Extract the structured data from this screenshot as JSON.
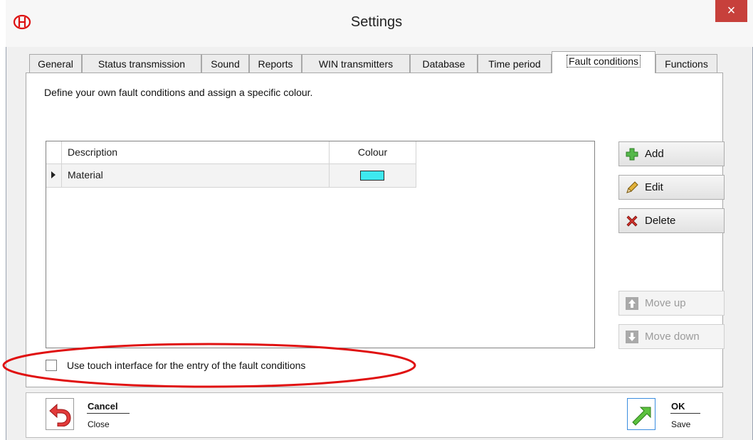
{
  "window": {
    "title": "Settings",
    "close_glyph": "×",
    "logo_icon": "company-logo"
  },
  "tabs": [
    {
      "label": "General",
      "active": false
    },
    {
      "label": "Status transmission",
      "active": false
    },
    {
      "label": "Sound",
      "active": false
    },
    {
      "label": "Reports",
      "active": false
    },
    {
      "label": "WIN transmitters",
      "active": false
    },
    {
      "label": "Database",
      "active": false
    },
    {
      "label": "Time period",
      "active": false
    },
    {
      "label": "Fault conditions",
      "active": true
    },
    {
      "label": "Functions",
      "active": false
    }
  ],
  "panel": {
    "description": "Define your own fault conditions and assign a specific colour.",
    "grid": {
      "columns": [
        "Description",
        "Colour"
      ],
      "rows": [
        {
          "description": "Material",
          "colour": "#3ee8ef"
        }
      ]
    },
    "buttons": {
      "add": "Add",
      "edit": "Edit",
      "delete": "Delete",
      "move_up": "Move up",
      "move_down": "Move down"
    },
    "touch_checkbox": {
      "label": "Use touch interface for the entry of the fault conditions",
      "checked": false
    }
  },
  "footer": {
    "cancel": {
      "label": "Cancel",
      "sub": "Close"
    },
    "ok": {
      "label": "OK",
      "sub": "Save"
    }
  },
  "colors": {
    "close_button": "#c7403b",
    "highlight_ellipse": "#e01010",
    "swatch": "#3ee8ef"
  }
}
